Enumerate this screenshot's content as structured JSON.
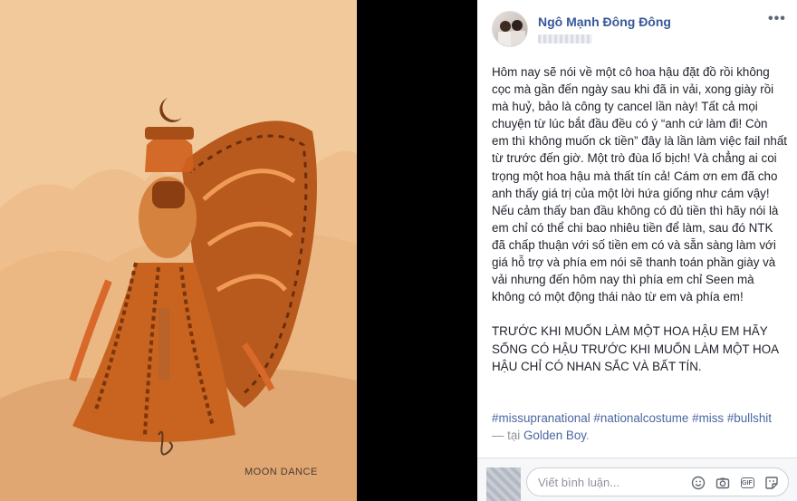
{
  "artwork": {
    "caption": "MOON DANCE"
  },
  "post": {
    "author": "Ngô Mạnh Đông Đông",
    "more_label": "•••",
    "body": "Hôm nay sẽ nói về một cô hoa hậu đặt đồ rồi không cọc mà gần đến ngày sau khi đã in vải, xong giày rồi mà huỷ, bảo là công ty cancel lần này! Tất cả mọi chuyện từ lúc bắt đầu đều có ý “anh cứ làm đi! Còn em thì không muốn ck tiền” đây là lần làm việc fail nhất từ trước đến giờ. Một trò đùa lố bịch! Và chẳng ai coi trọng một hoa hậu mà thất tín cả! Cám ơn em đã cho anh thấy giá trị của một lời hứa giống như cám vậy!\nNếu cảm thấy ban đầu không có đủ tiền thì hãy nói là em chỉ có thể chi bao nhiêu tiền để làm, sau đó NTK đã chấp thuận với số tiền em có và sẵn sàng làm với giá hỗ trợ và phía em nói sẽ thanh toán phần giày và vải nhưng đến hôm nay thì phía em chỉ Seen mà không có một động thái nào từ em và phía em!\n\nTRƯỚC KHI MUỐN LÀM MỘT HOA HẬU EM HÃY SỐNG CÓ HẬU TRƯỚC KHI MUỐN LÀM MỘT HOA HẬU CHỈ CÓ NHAN SẮC VÀ BẤT TÍN.",
    "hashtags": [
      "#missupranational",
      "#nationalcostume",
      "#miss",
      "#bullshit"
    ],
    "place_prefix": "— tại",
    "place": "Golden Boy",
    "place_suffix": "."
  },
  "comment": {
    "placeholder": "Viết bình luận...",
    "icons": [
      "emoji-icon",
      "camera-icon",
      "gif-icon",
      "sticker-icon"
    ]
  },
  "colors": {
    "link": "#385898",
    "accent_bg": "#f1c99a"
  }
}
